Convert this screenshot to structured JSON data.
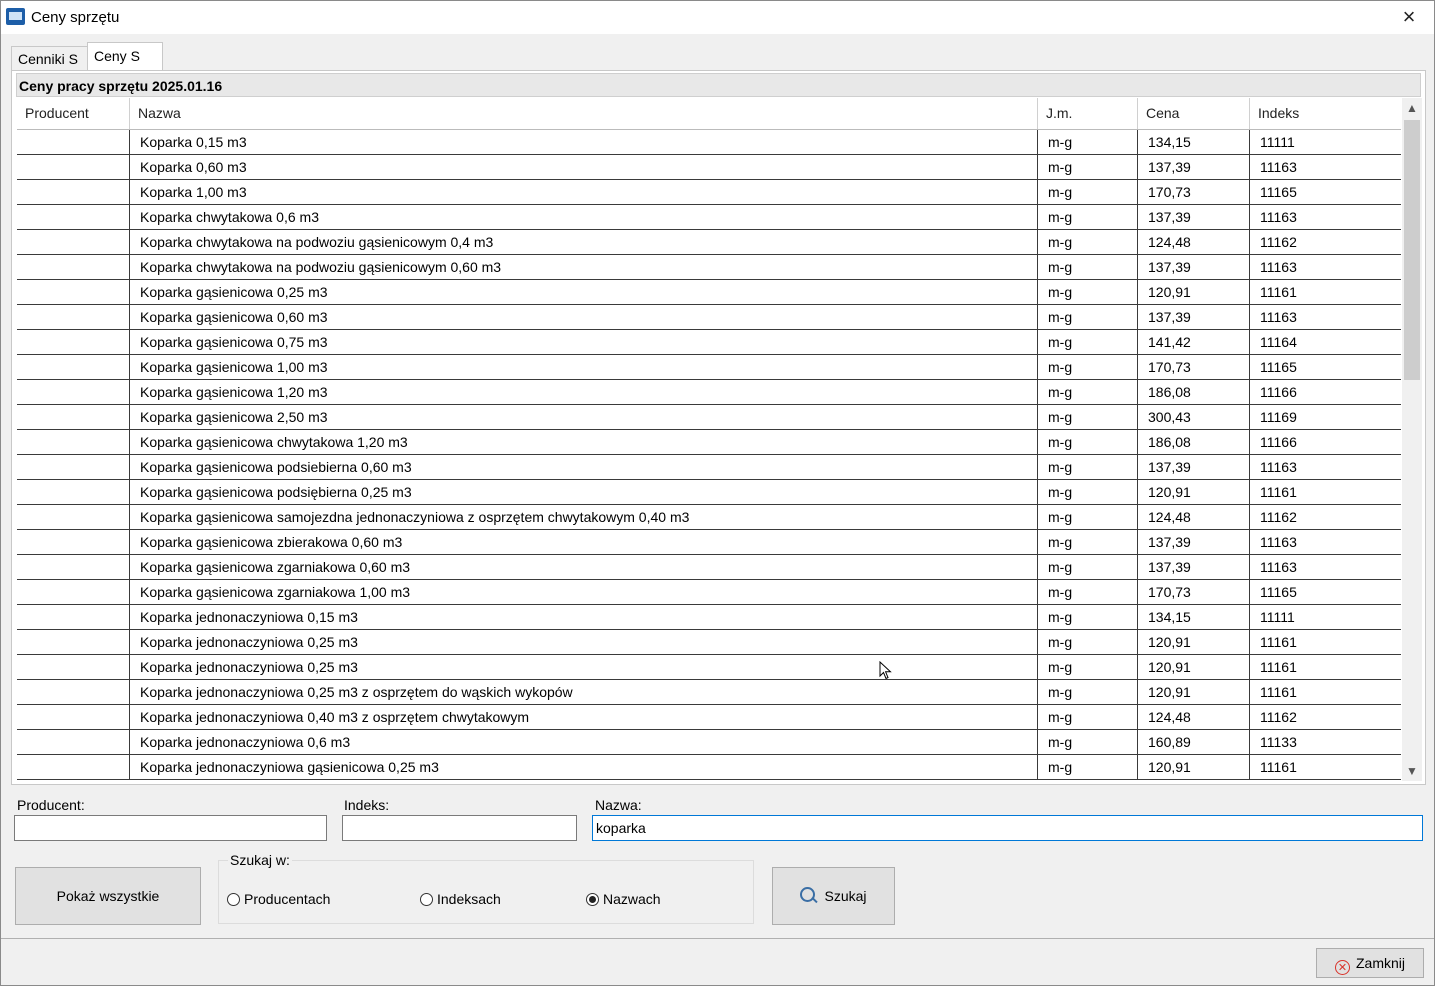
{
  "window": {
    "title": "Ceny sprzętu",
    "close_glyph": "×"
  },
  "tabs": [
    {
      "label": "Cenniki S",
      "active": false
    },
    {
      "label": "Ceny S",
      "active": true
    }
  ],
  "group_title": "Ceny pracy sprzętu 2025.01.16",
  "table": {
    "columns": [
      "Producent",
      "Nazwa",
      "J.m.",
      "Cena",
      "Indeks"
    ],
    "rows": [
      [
        "",
        "Koparka 0,15 m3",
        "m-g",
        "134,15",
        "11111"
      ],
      [
        "",
        "Koparka 0,60 m3",
        "m-g",
        "137,39",
        "11163"
      ],
      [
        "",
        "Koparka 1,00 m3",
        "m-g",
        "170,73",
        "11165"
      ],
      [
        "",
        "Koparka chwytakowa 0,6 m3",
        "m-g",
        "137,39",
        "11163"
      ],
      [
        "",
        "Koparka chwytakowa na podwoziu gąsienicowym 0,4 m3",
        "m-g",
        "124,48",
        "11162"
      ],
      [
        "",
        "Koparka chwytakowa na podwoziu gąsienicowym 0,60 m3",
        "m-g",
        "137,39",
        "11163"
      ],
      [
        "",
        "Koparka gąsienicowa 0,25 m3",
        "m-g",
        "120,91",
        "11161"
      ],
      [
        "",
        "Koparka gąsienicowa 0,60 m3",
        "m-g",
        "137,39",
        "11163"
      ],
      [
        "",
        "Koparka gąsienicowa 0,75 m3",
        "m-g",
        "141,42",
        "11164"
      ],
      [
        "",
        "Koparka gąsienicowa 1,00 m3",
        "m-g",
        "170,73",
        "11165"
      ],
      [
        "",
        "Koparka gąsienicowa 1,20 m3",
        "m-g",
        "186,08",
        "11166"
      ],
      [
        "",
        "Koparka gąsienicowa 2,50 m3",
        "m-g",
        "300,43",
        "11169"
      ],
      [
        "",
        "Koparka gąsienicowa chwytakowa 1,20 m3",
        "m-g",
        "186,08",
        "11166"
      ],
      [
        "",
        "Koparka gąsienicowa podsiebierna 0,60 m3",
        "m-g",
        "137,39",
        "11163"
      ],
      [
        "",
        "Koparka gąsienicowa podsiębierna 0,25 m3",
        "m-g",
        "120,91",
        "11161"
      ],
      [
        "",
        "Koparka gąsienicowa samojezdna jednonaczyniowa z osprzętem chwytakowym 0,40 m3",
        "m-g",
        "124,48",
        "11162"
      ],
      [
        "",
        "Koparka gąsienicowa zbierakowa 0,60 m3",
        "m-g",
        "137,39",
        "11163"
      ],
      [
        "",
        "Koparka gąsienicowa zgarniakowa 0,60 m3",
        "m-g",
        "137,39",
        "11163"
      ],
      [
        "",
        "Koparka gąsienicowa zgarniakowa 1,00 m3",
        "m-g",
        "170,73",
        "11165"
      ],
      [
        "",
        "Koparka jednonaczyniowa 0,15 m3",
        "m-g",
        "134,15",
        "11111"
      ],
      [
        "",
        "Koparka jednonaczyniowa 0,25 m3",
        "m-g",
        "120,91",
        "11161"
      ],
      [
        "",
        "Koparka jednonaczyniowa 0,25 m3",
        "m-g",
        "120,91",
        "11161"
      ],
      [
        "",
        "Koparka jednonaczyniowa 0,25 m3 z osprzętem do wąskich wykopów",
        "m-g",
        "120,91",
        "11161"
      ],
      [
        "",
        "Koparka jednonaczyniowa 0,40 m3 z osprzętem chwytakowym",
        "m-g",
        "124,48",
        "11162"
      ],
      [
        "",
        "Koparka jednonaczyniowa 0,6 m3",
        "m-g",
        "160,89",
        "11133"
      ],
      [
        "",
        "Koparka jednonaczyniowa gąsienicowa 0,25 m3",
        "m-g",
        "120,91",
        "11161"
      ]
    ]
  },
  "filters": {
    "producent_label": "Producent:",
    "producent_value": "",
    "indeks_label": "Indeks:",
    "indeks_value": "",
    "nazwa_label": "Nazwa:",
    "nazwa_value": "koparka"
  },
  "buttons": {
    "show_all": "Pokaż wszystkie",
    "search": "Szukaj",
    "close": "Zamknij"
  },
  "search_in": {
    "label": "Szukaj w:",
    "options": [
      {
        "label": "Producentach",
        "selected": false
      },
      {
        "label": "Indeksach",
        "selected": false
      },
      {
        "label": "Nazwach",
        "selected": true
      }
    ]
  },
  "icons": {
    "app": "app-icon",
    "search": "search-icon",
    "close": "close-circle-icon",
    "cursor": "mouse-cursor-icon"
  }
}
